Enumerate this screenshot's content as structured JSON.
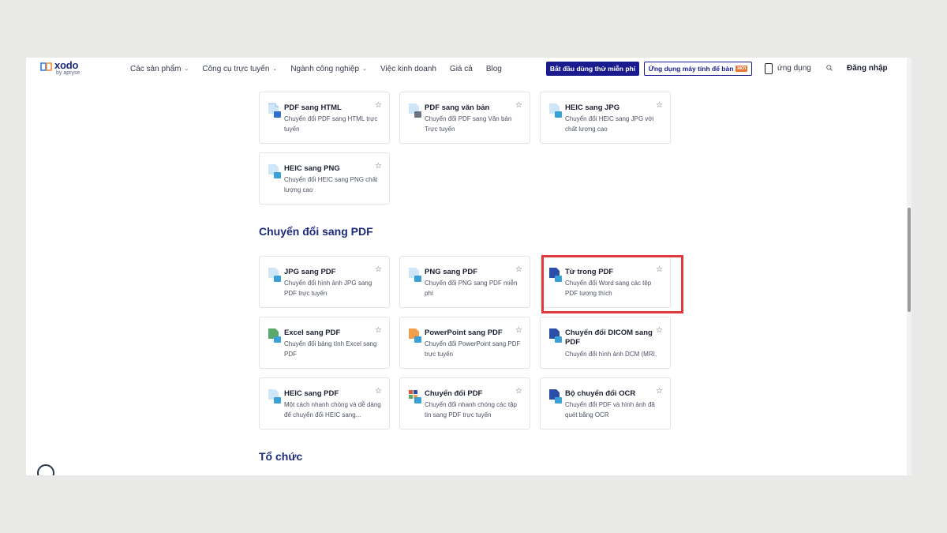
{
  "header": {
    "logo": {
      "name": "xodo",
      "sub": "by apryse"
    },
    "nav": [
      {
        "label": "Các sản phẩm",
        "dropdown": true
      },
      {
        "label": "Công cụ trực tuyến",
        "dropdown": true
      },
      {
        "label": "Ngành công nghiệp",
        "dropdown": true
      },
      {
        "label": "Việc kinh doanh",
        "dropdown": false
      },
      {
        "label": "Giá cả",
        "dropdown": false
      },
      {
        "label": "Blog",
        "dropdown": false
      }
    ],
    "cta_primary": "Bắt đầu dùng thử miễn phí",
    "cta_secondary": "Ứng dụng máy tính để bàn",
    "cta_secondary_badge": "MỚI",
    "app_label": "ứng dụng",
    "login": "Đăng nhập"
  },
  "sections": {
    "convert_to_pdf": "Chuyển đổi sang PDF",
    "organize": "Tổ chức"
  },
  "top_cards": [
    {
      "title": "PDF sang HTML",
      "desc": "Chuyển đổi PDF sang HTML trực tuyến"
    },
    {
      "title": "PDF sang văn bản",
      "desc": "Chuyển đổi PDF sang Văn bản Trực tuyến"
    },
    {
      "title": "HEIC sang JPG",
      "desc": "Chuyển đổi HEIC sang JPG với chất lượng cao"
    },
    {
      "title": "HEIC sang PNG",
      "desc": "Chuyển đổi HEIC sang PNG chất lượng cao"
    }
  ],
  "pdf_cards": [
    {
      "title": "JPG sang PDF",
      "desc": "Chuyển đổi hình ảnh JPG sang PDF trực tuyến"
    },
    {
      "title": "PNG sang PDF",
      "desc": "Chuyển đổi PNG sang PDF miễn phí"
    },
    {
      "title": "Từ trong PDF",
      "desc": "Chuyển đổi Word sang các tệp PDF tương thích"
    },
    {
      "title": "Excel sang PDF",
      "desc": "Chuyển đổi bảng tính Excel sang PDF"
    },
    {
      "title": "PowerPoint sang PDF",
      "desc": "Chuyển đổi PowerPoint sang PDF trực tuyến"
    },
    {
      "title": "Chuyển đổi DICOM sang PDF",
      "desc": "Chuyển đổi hình ảnh DCM (MRI,"
    },
    {
      "title": "HEIC sang PDF",
      "desc": "Một cách nhanh chóng và dễ dàng để chuyển đổi HEIC sang..."
    },
    {
      "title": "Chuyển đổi PDF",
      "desc": "Chuyển đổi nhanh chóng các tập tin sang PDF trực tuyến"
    },
    {
      "title": "Bộ chuyển đổi OCR",
      "desc": "Chuyển đổi PDF và hình ảnh đã quét bằng OCR"
    }
  ],
  "star_glyph": "☆",
  "colors": {
    "brand": "#1c2a7c",
    "primary_button": "#1a1b8f",
    "highlight": "#e0383c"
  }
}
